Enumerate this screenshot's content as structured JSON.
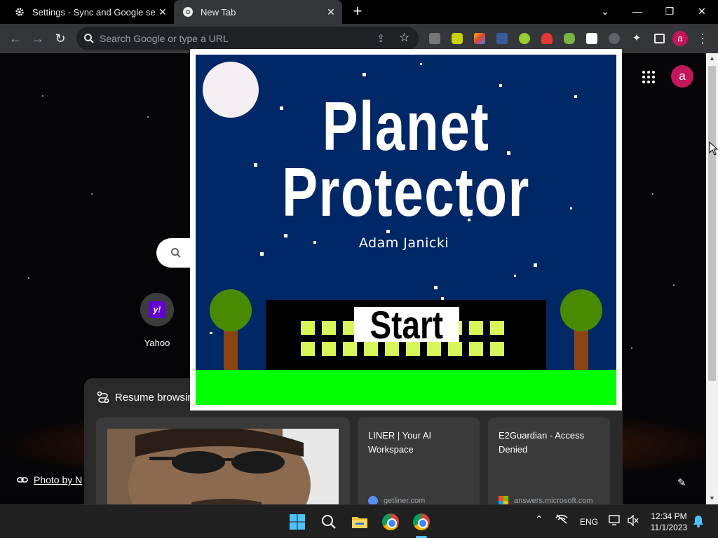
{
  "tabs": [
    {
      "title": "Settings - Sync and Google servi",
      "icon": "gear-icon",
      "active": false
    },
    {
      "title": "New Tab",
      "icon": "chrome-icon",
      "active": true
    }
  ],
  "window_controls": [
    "minimize",
    "restore",
    "close"
  ],
  "omnibox": {
    "placeholder": "Search Google or type a URL"
  },
  "profile": {
    "initial": "a",
    "color": "#c2185b"
  },
  "ntp": {
    "shortcut_label": "Yahoo",
    "shortcut_icon_text": "y!",
    "resume_title": "Resume browsin",
    "cards": [
      {
        "title": "LINER | Your AI Workspace",
        "domain": "getliner.com"
      },
      {
        "title": "E2Guardian - Access Denied",
        "domain": "answers.microsoft.com"
      }
    ],
    "credit": "Photo by N"
  },
  "game": {
    "title_line1": "Planet",
    "title_line2": "Protector",
    "author": "Adam Janicki",
    "start_label": "Start",
    "colors": {
      "sky": "#002766",
      "grass": "#00ff00",
      "building": "#000000",
      "window": "#d8f55a",
      "tree": "#4a8a00",
      "trunk": "#8b4513",
      "moon": "#f5eef2"
    }
  },
  "taskbar": {
    "language": "ENG",
    "time": "12:34 PM",
    "date": "11/1/2023"
  }
}
